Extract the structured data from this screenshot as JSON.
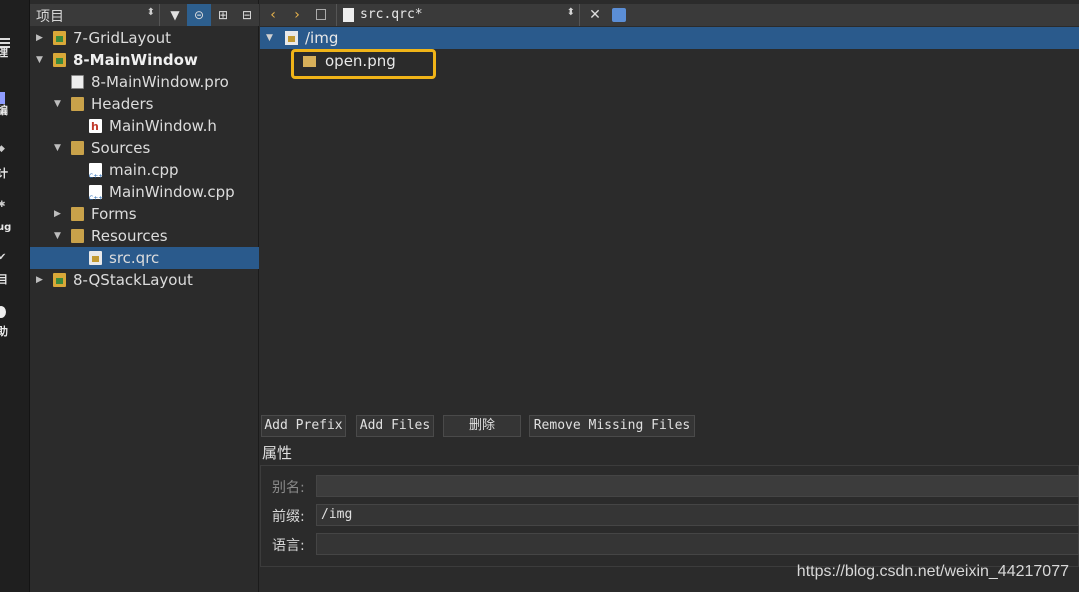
{
  "modebar": {
    "items": [
      {
        "label": "理",
        "icon": "welcome-grid-icon"
      },
      {
        "label": "编",
        "icon": "edit-icon"
      },
      {
        "label": "计",
        "icon": "design-icon"
      },
      {
        "label": "ug",
        "icon": "debug-icon"
      },
      {
        "label": "目",
        "icon": "projects-icon"
      },
      {
        "label": "助",
        "icon": "help-icon"
      }
    ]
  },
  "project_panel": {
    "combo_label": "项目",
    "tree": [
      {
        "label": "7-GridLayout",
        "type": "project",
        "expanded": false
      },
      {
        "label": "8-MainWindow",
        "type": "project",
        "expanded": true,
        "bold": true
      },
      {
        "label": "8-MainWindow.pro",
        "type": "pro"
      },
      {
        "label": "Headers",
        "type": "folder",
        "expanded": true
      },
      {
        "label": "MainWindow.h",
        "type": "header"
      },
      {
        "label": "Sources",
        "type": "folder",
        "expanded": true
      },
      {
        "label": "main.cpp",
        "type": "cpp"
      },
      {
        "label": "MainWindow.cpp",
        "type": "cpp"
      },
      {
        "label": "Forms",
        "type": "folder",
        "expanded": false
      },
      {
        "label": "Resources",
        "type": "folder",
        "expanded": true
      },
      {
        "label": "src.qrc",
        "type": "qrc",
        "selected": true
      },
      {
        "label": "8-QStackLayout",
        "type": "project",
        "expanded": false
      }
    ]
  },
  "editor_toolbar": {
    "document": "src.qrc*"
  },
  "resource_tree": {
    "prefix": "/img",
    "file": "open.png"
  },
  "buttons": {
    "add_prefix": "Add Prefix",
    "add_files": "Add Files",
    "delete": "删除",
    "remove_missing": "Remove Missing Files"
  },
  "properties": {
    "title": "属性",
    "alias_label": "别名:",
    "alias_value": "",
    "prefix_label": "前缀:",
    "prefix_value": "/img",
    "language_label": "语言:",
    "language_value": ""
  },
  "watermark": "https://blog.csdn.net/weixin_44217077",
  "colors": {
    "selection": "#2a5a8c",
    "highlight_box": "#f0b418",
    "background": "#2b2b2b"
  }
}
